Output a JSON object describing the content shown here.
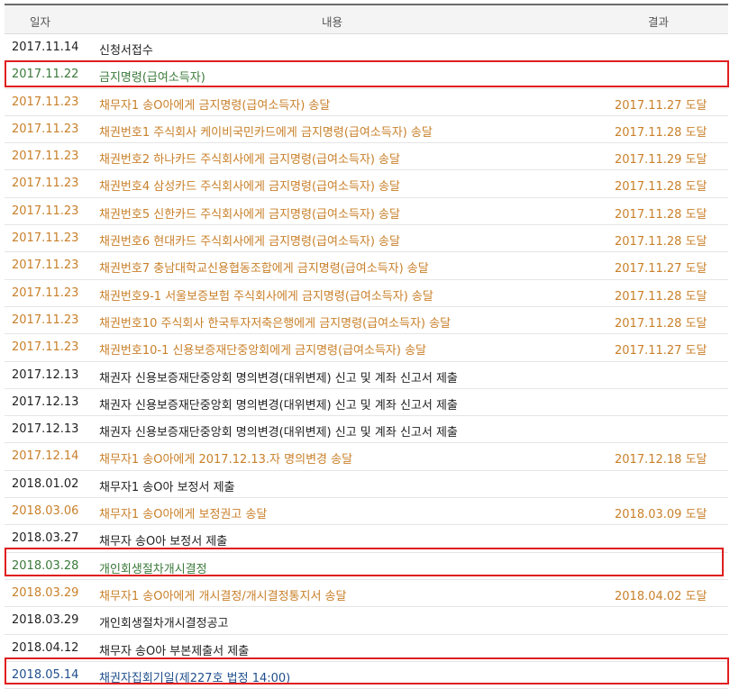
{
  "headers": {
    "date": "일자",
    "content": "내용",
    "result": "결과"
  },
  "rows": [
    {
      "date": "2017.11.14",
      "content": "신청서접수",
      "result": "",
      "color": "black"
    },
    {
      "date": "2017.11.22",
      "content": "금지명령(급여소득자)",
      "result": "",
      "color": "green"
    },
    {
      "date": "2017.11.23",
      "content": "채무자1 송O아에게 금지명령(급여소득자) 송달",
      "result": "2017.11.27 도달",
      "color": "orange"
    },
    {
      "date": "2017.11.23",
      "content": "채권번호1 주식회사 케이비국민카드에게 금지명령(급여소득자) 송달",
      "result": "2017.11.28 도달",
      "color": "orange"
    },
    {
      "date": "2017.11.23",
      "content": "채권번호2 하나카드 주식회사에게 금지명령(급여소득자) 송달",
      "result": "2017.11.29 도달",
      "color": "orange"
    },
    {
      "date": "2017.11.23",
      "content": "채권번호4 삼성카드 주식회사에게 금지명령(급여소득자) 송달",
      "result": "2017.11.28 도달",
      "color": "orange"
    },
    {
      "date": "2017.11.23",
      "content": "채권번호5 신한카드 주식회사에게 금지명령(급여소득자) 송달",
      "result": "2017.11.28 도달",
      "color": "orange"
    },
    {
      "date": "2017.11.23",
      "content": "채권번호6 현대카드 주식회사에게 금지명령(급여소득자) 송달",
      "result": "2017.11.28 도달",
      "color": "orange"
    },
    {
      "date": "2017.11.23",
      "content": "채권번호7 충남대학교신용협동조합에게 금지명령(급여소득자) 송달",
      "result": "2017.11.27 도달",
      "color": "orange"
    },
    {
      "date": "2017.11.23",
      "content": "채권번호9-1 서울보증보험 주식회사에게 금지명령(급여소득자) 송달",
      "result": "2017.11.28 도달",
      "color": "orange"
    },
    {
      "date": "2017.11.23",
      "content": "채권번호10 주식회사 한국투자저축은행에게 금지명령(급여소득자) 송달",
      "result": "2017.11.28 도달",
      "color": "orange"
    },
    {
      "date": "2017.11.23",
      "content": "채권번호10-1 신용보증재단중앙회에게 금지명령(급여소득자) 송달",
      "result": "2017.11.27 도달",
      "color": "orange"
    },
    {
      "date": "2017.12.13",
      "content": "채권자 신용보증재단중앙회 명의변경(대위변제) 신고 및 계좌 신고서 제출",
      "result": "",
      "color": "black"
    },
    {
      "date": "2017.12.13",
      "content": "채권자 신용보증재단중앙회 명의변경(대위변제) 신고 및 계좌 신고서 제출",
      "result": "",
      "color": "black"
    },
    {
      "date": "2017.12.13",
      "content": "채권자 신용보증재단중앙회 명의변경(대위변제) 신고 및 계좌 신고서 제출",
      "result": "",
      "color": "black"
    },
    {
      "date": "2017.12.14",
      "content": "채무자1 송O아에게 2017.12.13.자 명의변경 송달",
      "result": "2017.12.18 도달",
      "color": "orange"
    },
    {
      "date": "2018.01.02",
      "content": "채무자1 송O아 보정서 제출",
      "result": "",
      "color": "black"
    },
    {
      "date": "2018.03.06",
      "content": "채무자1 송O아에게 보정권고 송달",
      "result": "2018.03.09 도달",
      "color": "orange"
    },
    {
      "date": "2018.03.27",
      "content": "채무자 송O아 보정서 제출",
      "result": "",
      "color": "black"
    },
    {
      "date": "2018.03.28",
      "content": "개인회생절차개시결정",
      "result": "",
      "color": "green"
    },
    {
      "date": "2018.03.29",
      "content": "채무자1 송O아에게 개시결정/개시결정통지서 송달",
      "result": "2018.04.02 도달",
      "color": "orange"
    },
    {
      "date": "2018.03.29",
      "content": "개인회생절차개시결정공고",
      "result": "",
      "color": "black"
    },
    {
      "date": "2018.04.12",
      "content": "채무자 송O아 부본제출서 제출",
      "result": "",
      "color": "black"
    },
    {
      "date": "2018.05.14",
      "content": "채권자집회기일(제227호 법정 14:00)",
      "result": "",
      "color": "blue"
    }
  ],
  "highlight_color": "#e01e1e"
}
